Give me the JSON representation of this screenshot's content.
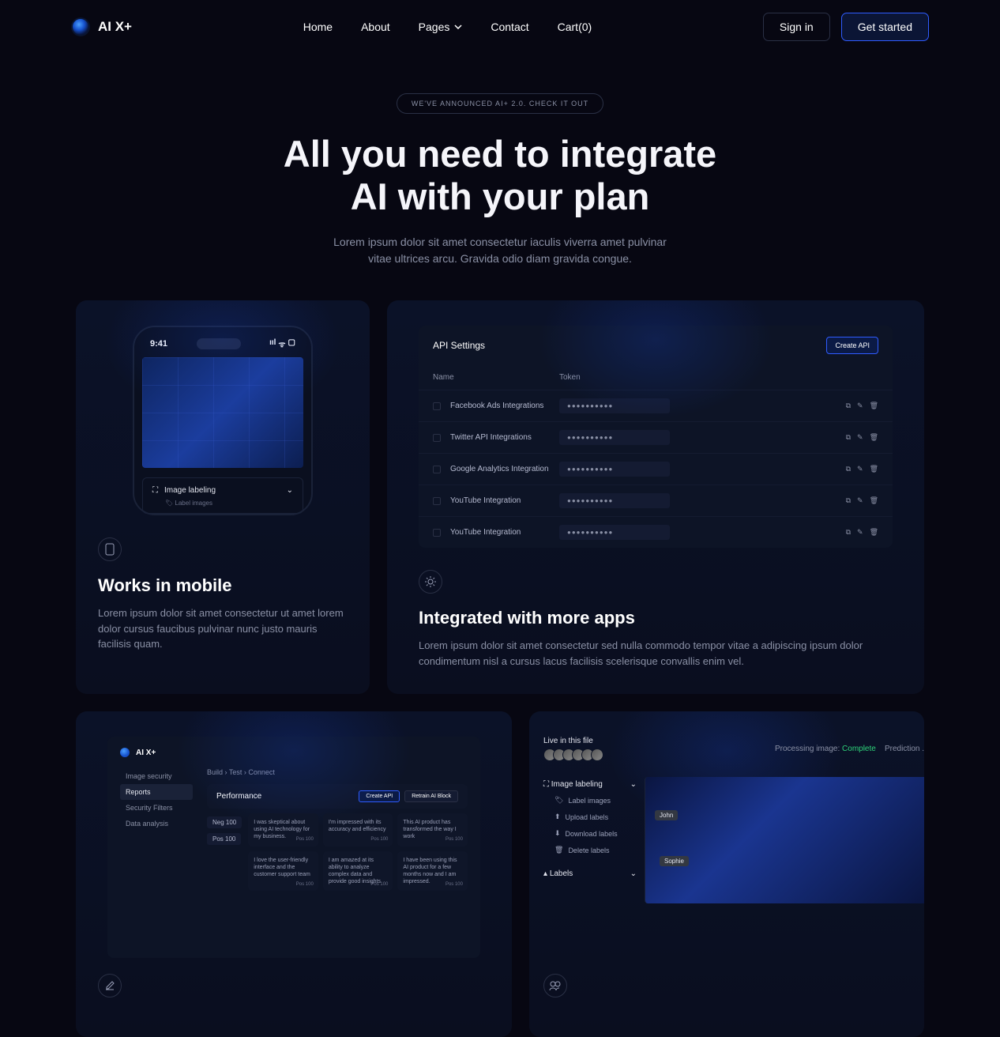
{
  "brand": "AI X+",
  "nav": {
    "home": "Home",
    "about": "About",
    "pages": "Pages",
    "contact": "Contact",
    "cart": "Cart(0)",
    "signin": "Sign in",
    "getstarted": "Get started"
  },
  "hero": {
    "badge": "WE'VE ANNOUNCED AI+ 2.0. CHECK IT OUT",
    "h1a": "All you need to integrate",
    "h1b": "AI with your plan",
    "p1": "Lorem ipsum dolor sit amet consectetur iaculis viverra amet pulvinar",
    "p2": "vitae ultrices arcu. Gravida odio diam gravida congue."
  },
  "card1": {
    "time": "9:41",
    "imgLabel": "Image labeling",
    "labelImages": "Label images",
    "title": "Works in mobile",
    "desc": "Lorem ipsum dolor sit amet consectetur ut amet lorem dolor cursus faucibus pulvinar nunc justo mauris facilisis quam."
  },
  "card2": {
    "panelTitle": "API Settings",
    "createApi": "Create API",
    "colName": "Name",
    "colToken": "Token",
    "rows": [
      {
        "name": "Facebook Ads Integrations"
      },
      {
        "name": "Twitter API Integrations"
      },
      {
        "name": "Google Analytics Integration"
      },
      {
        "name": "YouTube Integration"
      },
      {
        "name": "YouTube Integration"
      }
    ],
    "tokenMask": "●●●●●●●●●●",
    "title": "Integrated with more apps",
    "desc": "Lorem ipsum dolor sit amet consectetur sed nulla commodo tempor vitae a adipiscing ipsum dolor condimentum nisl a cursus lacus facilisis scelerisque convallis enim vel."
  },
  "card3": {
    "sidebar": [
      "Image security",
      "Reports",
      "Security Filters",
      "Data analysis"
    ],
    "crumbs": "Build  ›  Test  ›  Connect",
    "perfTitle": "Performance",
    "btnCreate": "Create API",
    "btnRetrain": "Retrain AI Block",
    "neg": "Neg 100",
    "pos": "Pos 100",
    "reviews": [
      {
        "t": "I was skeptical about using AI technology for my business.",
        "p": "Pos 100"
      },
      {
        "t": "I'm impressed with its accuracy and efficiency",
        "p": "Pos 100"
      },
      {
        "t": "This AI product has transformed the way I work",
        "p": "Pos 100"
      },
      {
        "t": "I love the user-friendly interface and the customer support team",
        "p": "Pos 100"
      },
      {
        "t": "I am amazed at its ability to analyze complex data and provide good insights",
        "p": "Pos 100"
      },
      {
        "t": "I have been using this AI product for a few months now and I am impressed.",
        "p": "Pos 100"
      }
    ]
  },
  "card4": {
    "live": "Live in this file",
    "proc": "Processing image: ",
    "complete": "Complete",
    "pred": "Prediction .",
    "imgLabel": "Image labeling",
    "items": [
      "Label images",
      "Upload labels",
      "Download labels",
      "Delete labels"
    ],
    "labels": "Labels",
    "tag1": "John",
    "tag2": "Sophie"
  }
}
